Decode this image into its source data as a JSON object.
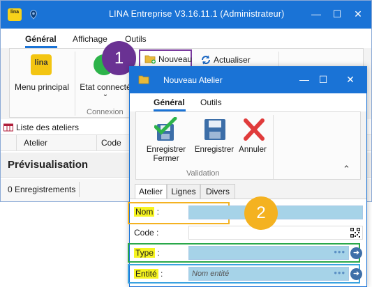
{
  "window": {
    "title": "LINA Entreprise  V3.16.11.1  (Administrateur)",
    "logo_text": "lina"
  },
  "main_tabs": [
    {
      "label": "Général"
    },
    {
      "label": "Affichage"
    },
    {
      "label": "Outils"
    }
  ],
  "ribbon": {
    "menu_principal": "Menu principal",
    "etat_connecte": "Etat connecté",
    "connexion_group": "Connexion",
    "nouveau": "Nouveau",
    "actualiser": "Actualiser",
    "lina_icon_text": "lina"
  },
  "list": {
    "title": "Liste des ateliers",
    "columns": [
      "Atelier",
      "Code"
    ],
    "preview": "Prévisualisation",
    "status": "0 Enregistrements"
  },
  "badges": {
    "one": "1",
    "two": "2"
  },
  "dialog": {
    "title": "Nouveau Atelier",
    "tabs": [
      {
        "label": "Général"
      },
      {
        "label": "Outils"
      }
    ],
    "actions": [
      {
        "label": "Enregistrer Fermer"
      },
      {
        "label": "Enregistrer"
      },
      {
        "label": "Annuler"
      }
    ],
    "group_label": "Validation",
    "form_tabs": [
      "Atelier",
      "Lignes",
      "Divers"
    ],
    "fields": {
      "nom": {
        "label": "Nom",
        "suffix": " :"
      },
      "code": {
        "label": "Code :"
      },
      "type": {
        "label": "Type",
        "suffix": " :"
      },
      "entite": {
        "label": "Entité",
        "suffix": " :",
        "placeholder": "Nom entité"
      }
    }
  },
  "colors": {
    "accent": "#1a73d6",
    "badge_purple": "#6a3293",
    "badge_orange": "#f4b221",
    "highlight": "#f6f421",
    "frame_orange": "#f4b221",
    "frame_green": "#2aa84a",
    "frame_blue": "#3aa3e0"
  }
}
